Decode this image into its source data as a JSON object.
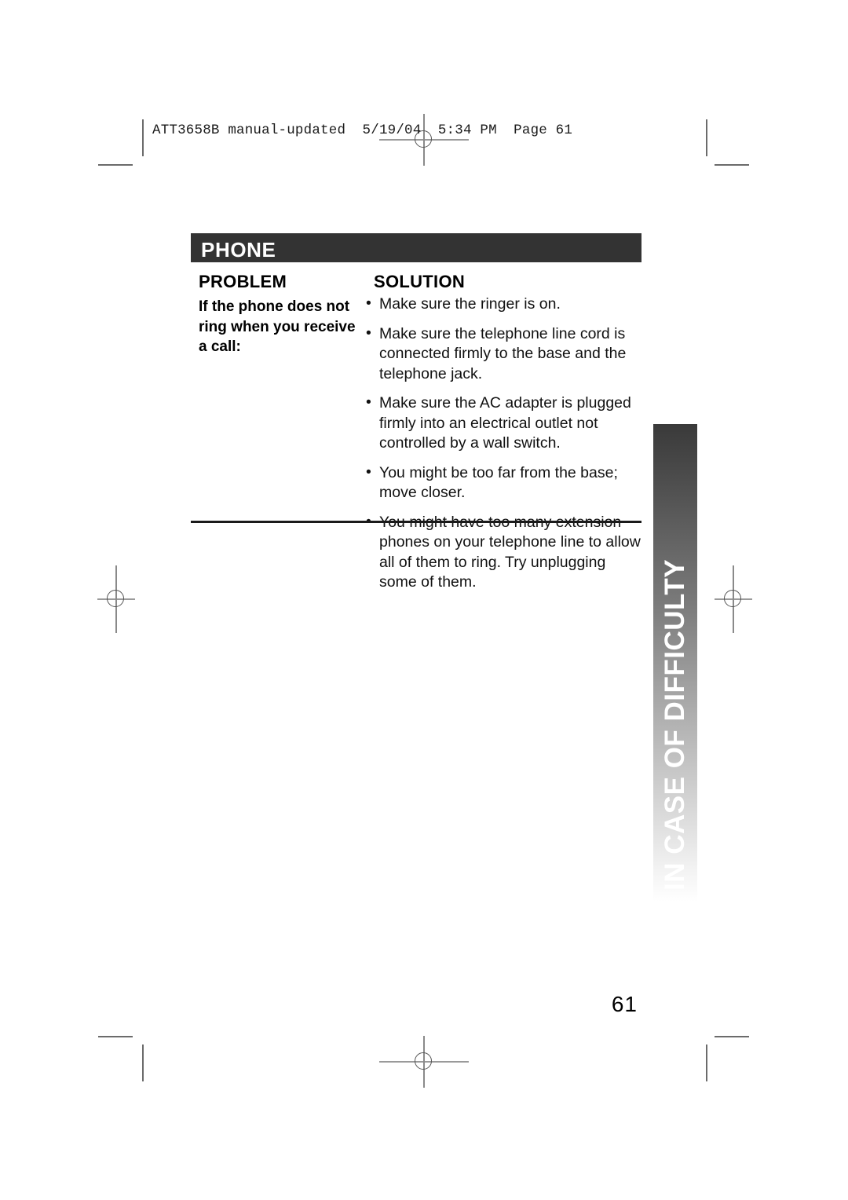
{
  "header": {
    "slug": "ATT3658B manual-updated  5/19/04  5:34 PM  Page 61"
  },
  "side_tab": {
    "label": "IN CASE OF DIFFICULTY",
    "gradient_from": "#3a3a3a",
    "gradient_to": "#ffffff",
    "text_color": "#ffffff"
  },
  "banner": {
    "title": "PHONE",
    "background": "#333333",
    "text_color": "#ffffff"
  },
  "table": {
    "columns": {
      "problem_header": "PROBLEM",
      "solution_header": "SOLUTION"
    },
    "rows": [
      {
        "problem": "If the phone does not ring when you receive a call:",
        "bullet_glyph": "•",
        "solutions": [
          "Make sure the ringer is on.",
          "Make sure the telephone line cord is connected firmly to the base and the telephone jack.",
          "Make sure the AC adapter is plugged firmly into an electrical outlet not controlled by a wall switch.",
          "You might be too far from the base; move closer.",
          "You might have too many extension phones on your telephone line to allow all of them to ring. Try unplugging some of them."
        ]
      }
    ]
  },
  "footer": {
    "page_number": "61"
  }
}
